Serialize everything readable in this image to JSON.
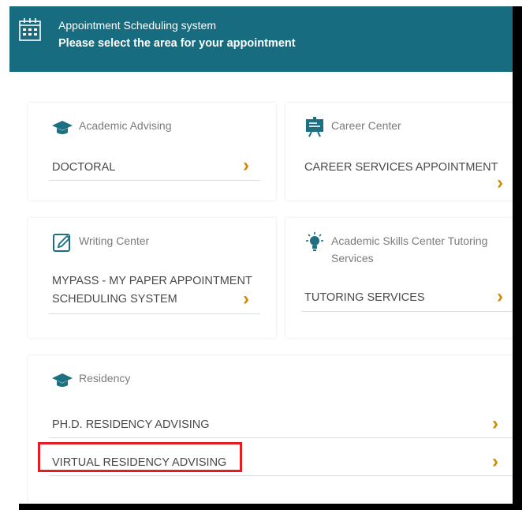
{
  "header": {
    "title": "Appointment Scheduling system",
    "subtitle": "Please select the area for your appointment",
    "icon": "calendar-icon"
  },
  "cards": {
    "academic_advising": {
      "title": "Academic Advising",
      "icon": "graduation-cap-icon",
      "items": [
        "DOCTORAL"
      ]
    },
    "career_center": {
      "title": "Career Center",
      "icon": "presentation-board-icon",
      "items": [
        "CAREER SERVICES APPOINTMENT"
      ]
    },
    "writing_center": {
      "title": "Writing Center",
      "icon": "pencil-edit-icon",
      "items": [
        "MYPASS - MY PAPER APPOINTMENT",
        "SCHEDULING SYSTEM"
      ]
    },
    "academic_skills": {
      "title_line1": "Academic Skills Center Tutoring",
      "title_line2": "Services",
      "icon": "lightbulb-icon",
      "items": [
        "TUTORING SERVICES"
      ]
    },
    "residency": {
      "title": "Residency",
      "icon": "graduation-cap-icon",
      "items": [
        "PH.D. RESIDENCY ADVISING",
        "VIRTUAL RESIDENCY ADVISING"
      ]
    }
  },
  "chevron": "›",
  "colors": {
    "header_bg": "#176d7f",
    "chevron": "#d08a00",
    "highlight": "#e51c23",
    "icon": "#1f6f82"
  }
}
